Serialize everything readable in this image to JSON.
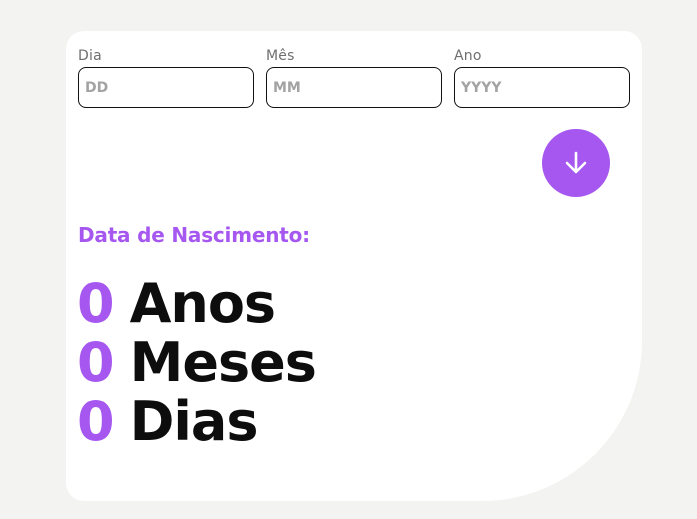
{
  "form": {
    "day": {
      "label": "Dia",
      "placeholder": "DD",
      "value": ""
    },
    "month": {
      "label": "Mês",
      "placeholder": "MM",
      "value": ""
    },
    "year": {
      "label": "Ano",
      "placeholder": "YYYY",
      "value": ""
    },
    "submit_icon": "arrow-down-icon"
  },
  "result": {
    "heading": "Data de Nascimento:",
    "years": {
      "value": "0",
      "unit": "Anos"
    },
    "months": {
      "value": "0",
      "unit": "Meses"
    },
    "days": {
      "value": "0",
      "unit": "Dias"
    }
  },
  "colors": {
    "accent": "#a657f0",
    "background": "#f3f3f2",
    "card": "#ffffff",
    "text": "#0d0d0d"
  }
}
